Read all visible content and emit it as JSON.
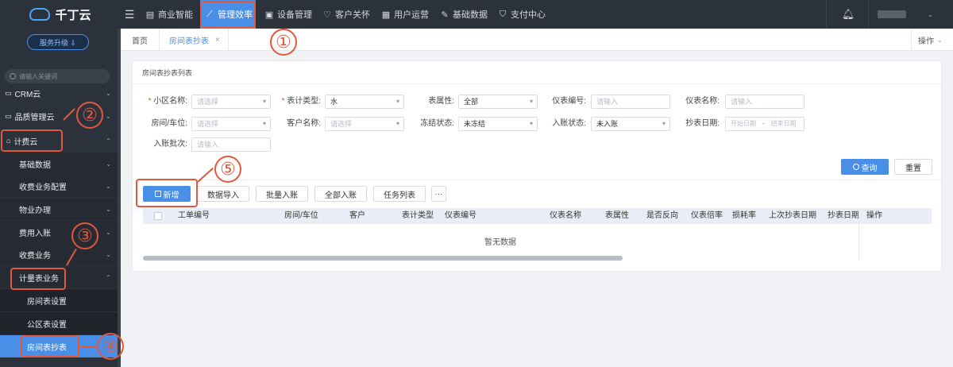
{
  "brand": {
    "name": "千丁云"
  },
  "nav": {
    "items": [
      {
        "label": "商业智能",
        "icon": "bar-chart-icon"
      },
      {
        "label": "管理效率",
        "icon": "trend-icon"
      },
      {
        "label": "设备管理",
        "icon": "device-icon"
      },
      {
        "label": "客户关怀",
        "icon": "heart-icon"
      },
      {
        "label": "用户运营",
        "icon": "user-ops-icon"
      },
      {
        "label": "基础数据",
        "icon": "wrench-icon"
      },
      {
        "label": "支付中心",
        "icon": "shield-icon"
      }
    ]
  },
  "sidebar": {
    "upgrade_label": "服务升级 ⇩",
    "search_placeholder": "请输入关键词",
    "menu": [
      {
        "label": "CRM云"
      },
      {
        "label": "品质管理云"
      },
      {
        "label": "计费云"
      },
      {
        "label": "基础数据"
      },
      {
        "label": "收费业务配置"
      },
      {
        "label": "物业办理"
      },
      {
        "label": "费用入账"
      },
      {
        "label": "收费业务"
      },
      {
        "label": "计量表业务"
      },
      {
        "label": "房间表设置"
      },
      {
        "label": "公区表设置"
      },
      {
        "label": "房间表抄表"
      }
    ]
  },
  "tabs": {
    "home": "首页",
    "current": "房间表抄表",
    "close": "×",
    "ops": "操作"
  },
  "panel": {
    "title": "房间表抄表列表"
  },
  "filters": {
    "community_label": "小区名称:",
    "community_placeholder": "请选择",
    "meter_type_label": "表计类型:",
    "meter_type_value": "水",
    "attr_label": "表属性:",
    "attr_value": "全部",
    "meter_no_label": "仪表编号:",
    "meter_no_placeholder": "请输入",
    "meter_name_label": "仪表名称:",
    "meter_name_placeholder": "请输入",
    "room_label": "房间/车位:",
    "room_placeholder": "请选择",
    "customer_label": "客户名称:",
    "customer_placeholder": "请选择",
    "freeze_label": "冻结状态:",
    "freeze_value": "未冻结",
    "account_label": "入账状态:",
    "account_value": "未入账",
    "date_label": "抄表日期:",
    "date_start": "开始日期",
    "date_sep": "-",
    "date_end": "结束日期",
    "batch_label": "入账批次:",
    "batch_placeholder": "请输入",
    "required_mark": "*"
  },
  "actions": {
    "query": "查询",
    "reset": "重置",
    "add": "新增",
    "import": "数据导入",
    "batch_account": "批量入账",
    "all_account": "全部入账",
    "task_list": "任务列表",
    "more": "···"
  },
  "table": {
    "columns": [
      "工单编号",
      "房间/车位",
      "客户",
      "表计类型",
      "仪表编号",
      "仪表名称",
      "表属性",
      "是否反向",
      "仪表倍率",
      "损耗率",
      "上次抄表日期",
      "抄表日期",
      "操作"
    ],
    "empty": "暂无数据"
  },
  "annotations": [
    "①",
    "②",
    "③",
    "④",
    "⑤"
  ],
  "colors": {
    "annotation": "#e2583e",
    "primary": "#4a8fe7",
    "dark": "#2c323b"
  }
}
